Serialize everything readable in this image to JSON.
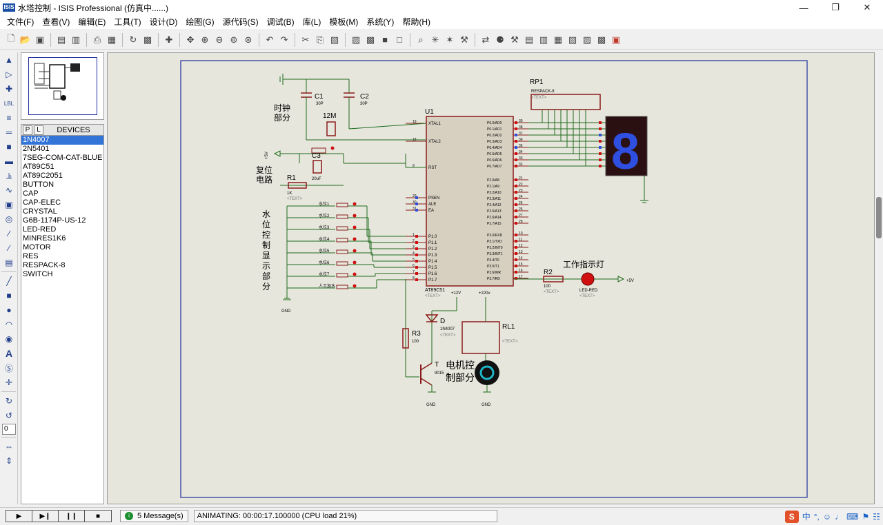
{
  "window": {
    "app_icon": "ISIS",
    "title": "水塔控制 - ISIS Professional (仿真中......)",
    "minimize_icon": "minimize-icon",
    "restore_icon": "restore-icon",
    "close_icon": "close-icon"
  },
  "menu": [
    "文件(F)",
    "查看(V)",
    "编辑(E)",
    "工具(T)",
    "设计(D)",
    "绘图(G)",
    "源代码(S)",
    "调试(B)",
    "库(L)",
    "模板(M)",
    "系统(Y)",
    "帮助(H)"
  ],
  "devices": {
    "tab_p": "P",
    "tab_l": "L",
    "header": "DEVICES",
    "items": [
      "1N4007",
      "2N5401",
      "7SEG-COM-CAT-BLUE",
      "AT89C51",
      "AT89C2051",
      "BUTTON",
      "CAP",
      "CAP-ELEC",
      "CRYSTAL",
      "G6B-1174P-US-12",
      "LED-RED",
      "MINRES1K6",
      "MOTOR",
      "RES",
      "RESPACK-8",
      "SWITCH"
    ],
    "selected_index": 0
  },
  "left_tools": {
    "zoom_value": "0"
  },
  "schematic": {
    "clock_label": "时钟\n部分",
    "clock_l1": "时钟",
    "clock_l2": "部分",
    "reset_l1": "复位",
    "reset_l2": "电路",
    "water_label_chars": [
      "水",
      "位",
      "控",
      "制",
      "显",
      "示",
      "部",
      "分"
    ],
    "motor_l1": "电机控",
    "motor_l2": "制部分",
    "work_led_label": "工作指示灯",
    "c1_name": "C1",
    "c1_value": "30P",
    "c2_name": "C2",
    "c2_value": "30P",
    "crystal_value": "12M",
    "c3_name": "C3",
    "c3_value": "20uF",
    "r1_name": "R1",
    "r1_value": "1K",
    "r2_name": "R2",
    "r2_value": "100",
    "r3_name": "R3",
    "r3_value": "100",
    "rp1_name": "RP1",
    "rp1_value": "RESPACK-8",
    "u1_name": "U1",
    "u1_value": "AT89C51",
    "diode_name": "D",
    "diode_value": "1N4007",
    "transistor_name": "T",
    "transistor_value": "9015",
    "relay_name": "RL1",
    "led_value": "LED-RED",
    "vcc_label": "+5V",
    "vcc_label_2": "+5V",
    "gnd_label": "GND",
    "text_placeholder": "<TEXT>",
    "pwr_12v": "+12V",
    "pwr_220v": "+220v",
    "switch_labels": [
      "水位1",
      "水位2",
      "水位3",
      "水位4",
      "水位5",
      "水位6",
      "水位7",
      "人工加水"
    ],
    "u1_left_pins": [
      "XTAL1",
      "XTAL2",
      "RST",
      "PSEN",
      "ALE",
      "EA",
      "P1.0",
      "P1.1",
      "P1.2",
      "P1.3",
      "P1.4",
      "P1.5",
      "P1.6",
      "P1.7"
    ],
    "u1_left_nums": [
      "19",
      "18",
      "9",
      "29",
      "30",
      "31",
      "1",
      "2",
      "3",
      "4",
      "5",
      "6",
      "7",
      "8"
    ],
    "u1_right_pins": [
      "P0.0/AD0",
      "P0.1/AD1",
      "P0.2/AD2",
      "P0.3/AD3",
      "P0.4/AD4",
      "P0.5/AD5",
      "P0.6/AD6",
      "P0.7/AD7",
      "P2.0/A8",
      "P2.1/A9",
      "P2.2/A10",
      "P2.3/A11",
      "P2.4/A12",
      "P2.5/A13",
      "P2.6/A14",
      "P2.7/A15",
      "P3.0/RXD",
      "P3.1/TXD",
      "P3.2/INT0",
      "P3.3/INT1",
      "P3.4/T0",
      "P3.5/T1",
      "P3.6/WR",
      "P3.7/RD"
    ],
    "u1_right_nums": [
      "39",
      "38",
      "37",
      "36",
      "35",
      "34",
      "33",
      "32",
      "21",
      "22",
      "23",
      "24",
      "25",
      "26",
      "27",
      "28",
      "10",
      "11",
      "12",
      "13",
      "14",
      "15",
      "16",
      "17"
    ],
    "seven_seg_digit": "8"
  },
  "status": {
    "play_icon": "play-icon",
    "step_icon": "step-icon",
    "pause_icon": "pause-icon",
    "stop_icon": "stop-icon",
    "messages": "5 Message(s)",
    "animating": "ANIMATING: 00:00:17.100000 (CPU load 21%)",
    "ime_label": "中",
    "ime_punct": "°,"
  },
  "colors": {
    "canvas_bg": "#e6e6dc",
    "wire": "#1d6b1d",
    "component": "#8b1a1a",
    "sheet_border": "#1e2d9c",
    "seg_on": "#2f4fe0",
    "seg_bg": "#2a1010",
    "led_red": "#d01010"
  }
}
